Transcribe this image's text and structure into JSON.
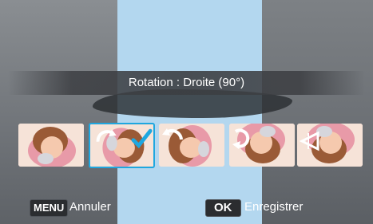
{
  "dialog": {
    "title": "Rotation : Droite (90°)"
  },
  "thumbnails": [
    {
      "option": "original",
      "icon": "none"
    },
    {
      "option": "rotate-right-90",
      "icon": "rotate-right-icon",
      "selected": true
    },
    {
      "option": "rotate-left-90",
      "icon": "rotate-left-icon"
    },
    {
      "option": "rotate-180",
      "icon": "rotate-180-icon"
    },
    {
      "option": "flip-horizontal",
      "icon": "flip-horizontal-icon"
    }
  ],
  "footer": {
    "cancel_key": "MENU",
    "cancel_label": "Annuler",
    "confirm_key": "OK",
    "confirm_label": "Enregistrer"
  },
  "colors": {
    "accent": "#1ea7e0",
    "panel": "#b3d7ef"
  }
}
